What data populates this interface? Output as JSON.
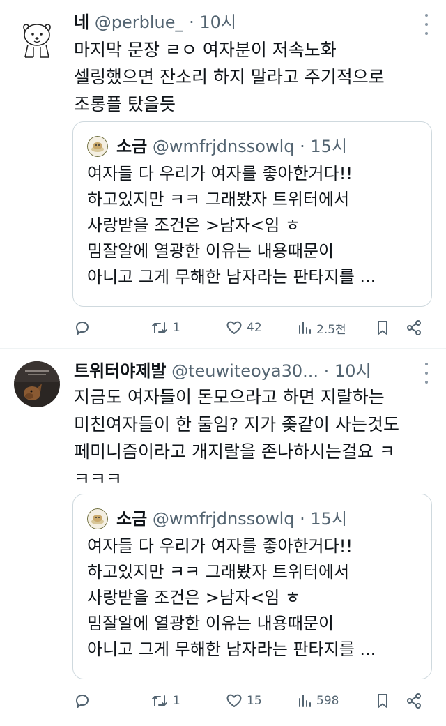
{
  "tweets": [
    {
      "name": "네",
      "handle": "@perblue_",
      "separator": "·",
      "time": "10시",
      "text_lines": [
        "마지막 문장 ㄹㅇ 여자분이 저속노화",
        "셀링했으면 잔소리 하지 말라고 주기적으로",
        "조롱플 탔을듯"
      ],
      "quote": {
        "name": "소금",
        "handle": "@wmfrjdnssowlq",
        "separator": "·",
        "time": "15시",
        "text_lines": [
          "여자들 다 우리가 여자를 좋아한거다!!",
          "하고있지만 ㅋㅋ 그래봤자 트위터에서",
          "사랑받을 조건은 >남자<임 ㅎ",
          "밈잘알에 열광한 이유는 내용때문이",
          "아니고 그게 무해한 남자라는 판타지를 ..."
        ]
      },
      "actions": {
        "reply": "",
        "retweet": "1",
        "like": "42",
        "views": "2.5천"
      }
    },
    {
      "name": "트위터야제발",
      "handle": "@teuwiteoya30...",
      "separator": "·",
      "time": "10시",
      "text_lines": [
        "지금도 여자들이 돈모으라고 하면 지랄하는",
        "미친여자들이 한 둘임? 지가 좆같이 사는것도",
        "페미니즘이라고 개지랄을 존나하시는걸요 ㅋ",
        "ㅋㅋㅋ"
      ],
      "quote": {
        "name": "소금",
        "handle": "@wmfrjdnssowlq",
        "separator": "·",
        "time": "15시",
        "text_lines": [
          "여자들 다 우리가 여자를 좋아한거다!!",
          "하고있지만 ㅋㅋ 그래봤자 트위터에서",
          "사랑받을 조건은 >남자<임 ㅎ",
          "밈잘알에 열광한 이유는 내용때문이",
          "아니고 그게 무해한 남자라는 판타지를 ..."
        ]
      },
      "actions": {
        "reply": "",
        "retweet": "1",
        "like": "15",
        "views": "598"
      }
    }
  ],
  "colors": {
    "text": "#0f1419",
    "secondary": "#536471",
    "border": "#cfd9de",
    "divider": "#eff3f4",
    "background": "#ffffff"
  },
  "icons": [
    "avatar-sketch-icon",
    "avatar-photo-icon",
    "more-icon",
    "reply-icon",
    "retweet-icon",
    "like-icon",
    "views-icon",
    "bookmark-icon",
    "share-icon"
  ]
}
